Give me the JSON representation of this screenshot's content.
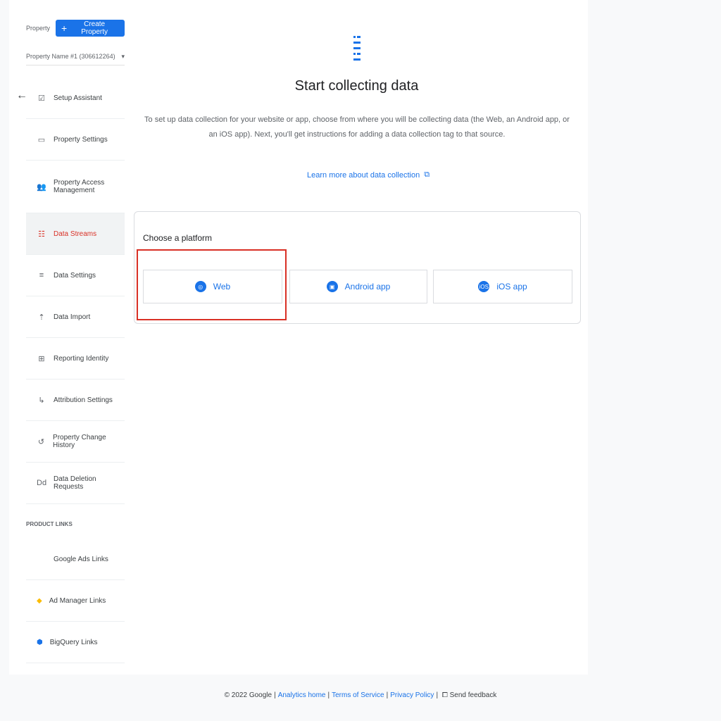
{
  "sidebar": {
    "property_label": "Property",
    "create_button_label": "Create Property",
    "property_select_value": "Property Name #1 (306612264)",
    "items": [
      {
        "label": "Setup Assistant",
        "icon": "checkbox-icon"
      },
      {
        "label": "Property Settings",
        "icon": "document-icon"
      },
      {
        "label": "Property Access Management",
        "icon": "people-icon"
      },
      {
        "label": "Data Streams",
        "icon": "streams-icon",
        "active": true
      },
      {
        "label": "Data Settings",
        "icon": "database-icon"
      },
      {
        "label": "Data Import",
        "icon": "upload-icon"
      },
      {
        "label": "Reporting Identity",
        "icon": "identity-icon"
      },
      {
        "label": "Attribution Settings",
        "icon": "attribution-icon"
      },
      {
        "label": "Property Change History",
        "icon": "history-icon"
      },
      {
        "label": "Data Deletion Requests",
        "icon": "dd-icon"
      }
    ],
    "product_links_label": "PRODUCT LINKS",
    "links": [
      {
        "label": "Google Ads Links",
        "icon": "google-ads-icon"
      },
      {
        "label": "Ad Manager Links",
        "icon": "ad-manager-icon"
      },
      {
        "label": "BigQuery Links",
        "icon": "bigquery-icon"
      }
    ]
  },
  "main": {
    "title": "Start collecting data",
    "description": "To set up data collection for your website or app, choose from where you will be collecting data (the Web, an Android app, or an iOS app). Next, you'll get instructions for adding a data collection tag to that source.",
    "learn_link": "Learn more about data collection",
    "platform_title": "Choose a platform",
    "platforms": [
      {
        "label": "Web",
        "icon": "globe-icon"
      },
      {
        "label": "Android app",
        "icon": "android-icon"
      },
      {
        "label": "iOS app",
        "icon": "ios-icon"
      }
    ]
  },
  "footer": {
    "copyright": "© 2022 Google",
    "analytics_home": "Analytics home",
    "terms": "Terms of Service",
    "privacy": "Privacy Policy",
    "feedback": "Send feedback"
  },
  "colors": {
    "accent": "#1a73e8",
    "active_text": "#d93025",
    "highlight": "#d93025"
  }
}
